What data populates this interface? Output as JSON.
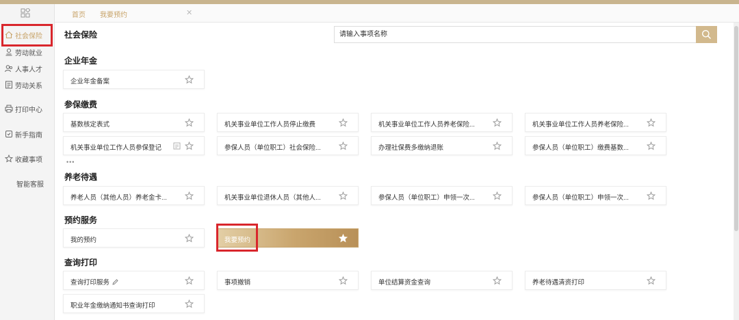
{
  "sidebar": {
    "items": [
      {
        "label": "社会保险",
        "icon": "home-icon"
      },
      {
        "label": "劳动就业",
        "icon": "user-badge-icon"
      },
      {
        "label": "人事人才",
        "icon": "users-icon"
      },
      {
        "label": "劳动关系",
        "icon": "document-icon"
      },
      {
        "label": "打印中心",
        "icon": "printer-icon"
      },
      {
        "label": "新手指南",
        "icon": "guide-icon"
      },
      {
        "label": "收藏事项",
        "icon": "star-icon"
      },
      {
        "label": "智能客服",
        "icon": ""
      }
    ]
  },
  "tabs": {
    "home": "首页",
    "current": "我要预约"
  },
  "header": {
    "title": "社会保险",
    "search_placeholder": "请输入事项名称"
  },
  "sections": [
    {
      "title": "企业年金",
      "cards": [
        "企业年金备案"
      ]
    },
    {
      "title": "参保缴费",
      "cards": [
        "基数核定表式",
        "机关事业单位工作人员停止缴费",
        "机关事业单位工作人员养老保险...",
        "机关事业单位工作人员养老保险...",
        "机关事业单位工作人员参保登记",
        "参保人员（单位职工）社会保险...",
        "办理社保费多缴纳退账",
        "参保人员（单位职工）缴费基数..."
      ],
      "more": "•••"
    },
    {
      "title": "养老待遇",
      "cards": [
        "养老人员（其他人员）养老金卡...",
        "机关事业单位退休人员（其他人...",
        "参保人员（单位职工）申领一次...",
        "参保人员（单位职工）申领一次..."
      ]
    },
    {
      "title": "预约服务",
      "cards": [
        "我的预约",
        "我要预约"
      ]
    },
    {
      "title": "查询打印",
      "cards": [
        "查询打印服务",
        "事项撤销",
        "单位结算资金查询",
        "养老待遇清资打印",
        "职业年金缴纳通知书查询打印"
      ]
    }
  ],
  "colors": {
    "accent": "#c8a46a",
    "highlight": "#d9262c",
    "search_button": "#d2b98d"
  }
}
